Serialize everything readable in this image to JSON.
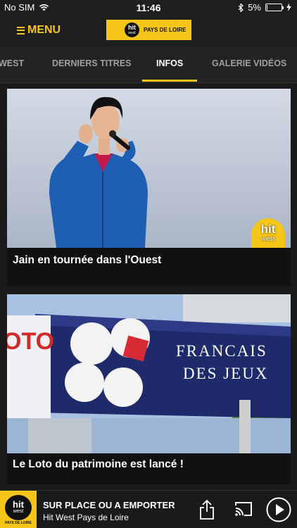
{
  "status_bar": {
    "carrier": "No SIM",
    "time": "11:46",
    "battery_percent": "5%",
    "battery_level": 0.05
  },
  "header": {
    "menu_label": "MENU",
    "logo": {
      "hit": "hit",
      "west": "west",
      "region": "PAYS DE LOIRE"
    }
  },
  "tabs": [
    {
      "label": "WEST"
    },
    {
      "label": "DERNIERS TITRES"
    },
    {
      "label": "INFOS",
      "active": true
    },
    {
      "label": "GALERIE VIDÉOS"
    }
  ],
  "articles": [
    {
      "title": "Jain en tournée dans l'Ouest",
      "badge_hit": "hit",
      "badge_west": "west"
    },
    {
      "title": "Le Loto du patrimoine est lancé !",
      "image_text": {
        "brand1": "FRANCAIS",
        "brand2": "DES JEUX",
        "side": "OTO"
      }
    }
  ],
  "player": {
    "logo_hit": "hit",
    "logo_west": "west",
    "logo_region": "PAYS DE LOIRE",
    "title": "SUR PLACE OU A EMPORTER",
    "subtitle": "Hit West Pays de Loire",
    "icons": [
      "share-icon",
      "cast-icon",
      "play-icon"
    ]
  },
  "colors": {
    "accent": "#f5c518",
    "background": "#1a1a1a"
  }
}
